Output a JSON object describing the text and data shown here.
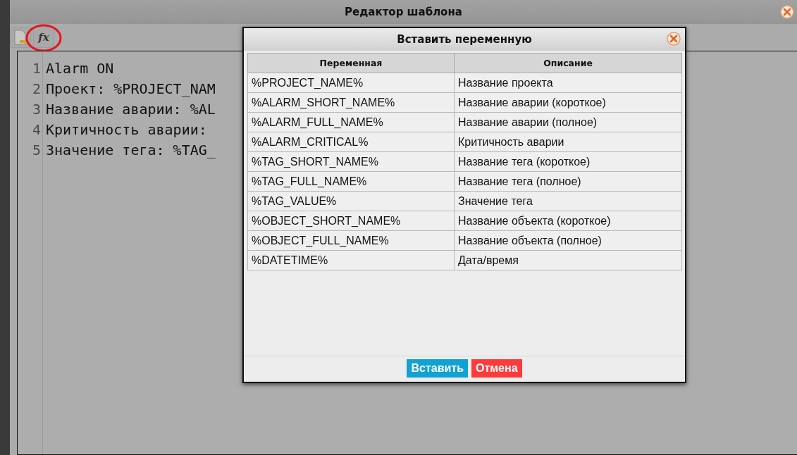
{
  "window": {
    "title": "Редактор шаблона"
  },
  "toolbar": {
    "tools": [
      {
        "kind": "document",
        "highlighted": false
      },
      {
        "kind": "function",
        "label": "fx",
        "highlighted": true
      }
    ]
  },
  "editor": {
    "lines": [
      {
        "number": "1",
        "text": "Alarm ON"
      },
      {
        "number": "2",
        "text": "Проект: %PROJECT_NAM"
      },
      {
        "number": "3",
        "text": "Название аварии: %AL"
      },
      {
        "number": "4",
        "text": "Критичность аварии:"
      },
      {
        "number": "5",
        "text": "Значение тега: %TAG_"
      }
    ]
  },
  "dialog": {
    "title": "Вставить переменную",
    "table": {
      "columns": [
        "Переменная",
        "Описание"
      ],
      "rows": [
        [
          "%PROJECT_NAME%",
          "Название проекта"
        ],
        [
          "%ALARM_SHORT_NAME%",
          "Название аварии (короткое)"
        ],
        [
          "%ALARM_FULL_NAME%",
          "Название аварии (полное)"
        ],
        [
          "%ALARM_CRITICAL%",
          "Критичность аварии"
        ],
        [
          "%TAG_SHORT_NAME%",
          "Название тега (короткое)"
        ],
        [
          "%TAG_FULL_NAME%",
          "Название тега (полное)"
        ],
        [
          "%TAG_VALUE%",
          "Значение тега"
        ],
        [
          "%OBJECT_SHORT_NAME%",
          "Название объекта (короткое)"
        ],
        [
          "%OBJECT_FULL_NAME%",
          "Название объекта (полное)"
        ],
        [
          "%DATETIME%",
          "Дата/время"
        ]
      ]
    },
    "buttons": [
      {
        "kind": "primary",
        "label": "Вставить"
      },
      {
        "kind": "danger",
        "label": "Отмена"
      }
    ]
  }
}
